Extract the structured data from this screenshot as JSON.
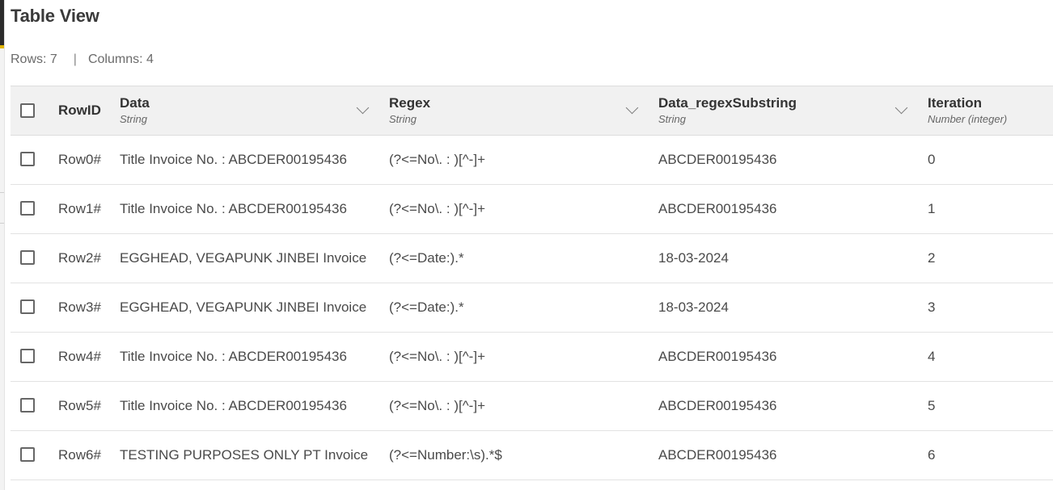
{
  "page": {
    "title": "Table View",
    "rows_label": "Rows: 7",
    "separator": "|",
    "columns_label": "Columns: 4"
  },
  "table": {
    "headers": {
      "rowid": "RowID",
      "columns": [
        {
          "name": "Data",
          "type": "String"
        },
        {
          "name": "Regex",
          "type": "String"
        },
        {
          "name": "Data_regexSubstring",
          "type": "String"
        },
        {
          "name": "Iteration",
          "type": "Number (integer)"
        }
      ]
    },
    "rows": [
      {
        "id": "Row0#",
        "data": "Title Invoice No. : ABCDER00195436",
        "regex": "(?<=No\\. : )[^-]+",
        "substring": "ABCDER00195436",
        "iteration": "0"
      },
      {
        "id": "Row1#",
        "data": "Title Invoice No. : ABCDER00195436",
        "regex": "(?<=No\\. : )[^-]+",
        "substring": "ABCDER00195436",
        "iteration": "1"
      },
      {
        "id": "Row2#",
        "data": "EGGHEAD, VEGAPUNK JINBEI Invoice",
        "regex": "(?<=Date:).*",
        "substring": "18-03-2024",
        "iteration": "2"
      },
      {
        "id": "Row3#",
        "data": "EGGHEAD, VEGAPUNK JINBEI Invoice",
        "regex": "(?<=Date:).*",
        "substring": "18-03-2024",
        "iteration": "3"
      },
      {
        "id": "Row4#",
        "data": "Title Invoice No. : ABCDER00195436",
        "regex": "(?<=No\\. : )[^-]+",
        "substring": "ABCDER00195436",
        "iteration": "4"
      },
      {
        "id": "Row5#",
        "data": "Title Invoice No. : ABCDER00195436",
        "regex": "(?<=No\\. : )[^-]+",
        "substring": "ABCDER00195436",
        "iteration": "5"
      },
      {
        "id": "Row6#",
        "data": "TESTING PURPOSES ONLY PT Invoice",
        "regex": "(?<=Number:\\s).*$",
        "substring": "ABCDER00195436",
        "iteration": "6"
      }
    ]
  }
}
